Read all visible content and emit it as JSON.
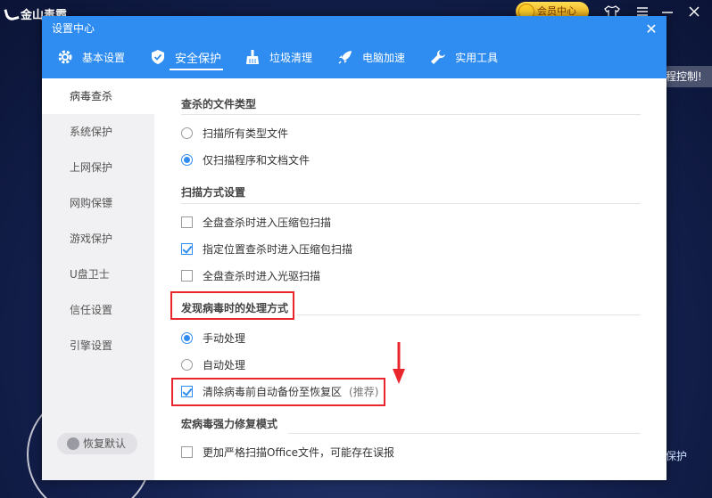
{
  "background_app": {
    "logo_text": "金山毒霸",
    "member_center": "会员中心",
    "side_tab_text": "程控制!",
    "bottom_link": "保护"
  },
  "dialog": {
    "title": "设置中心",
    "close_glyph": "✕"
  },
  "tabs": [
    {
      "label": "基本设置",
      "icon": "gear-icon",
      "active": false
    },
    {
      "label": "安全保护",
      "icon": "shield-icon",
      "active": true
    },
    {
      "label": "垃圾清理",
      "icon": "broom-icon",
      "active": false
    },
    {
      "label": "电脑加速",
      "icon": "rocket-icon",
      "active": false
    },
    {
      "label": "实用工具",
      "icon": "wrench-icon",
      "active": false
    }
  ],
  "sidebar": {
    "items": [
      {
        "label": "病毒查杀",
        "active": true
      },
      {
        "label": "系统保护",
        "active": false
      },
      {
        "label": "上网保护",
        "active": false
      },
      {
        "label": "网购保镖",
        "active": false
      },
      {
        "label": "游戏保护",
        "active": false
      },
      {
        "label": "U盘卫士",
        "active": false
      },
      {
        "label": "信任设置",
        "active": false
      },
      {
        "label": "引擎设置",
        "active": false
      }
    ],
    "restore_label": "恢复默认"
  },
  "sections": {
    "file_types": {
      "title": "查杀的文件类型",
      "options": [
        {
          "label": "扫描所有类型文件",
          "checked": false
        },
        {
          "label": "仅扫描程序和文档文件",
          "checked": true
        }
      ]
    },
    "scan_mode": {
      "title": "扫描方式设置",
      "options": [
        {
          "label": "全盘查杀时进入压缩包扫描",
          "checked": false
        },
        {
          "label": "指定位置查杀时进入压缩包扫描",
          "checked": true
        },
        {
          "label": "全盘查杀时进入光驱扫描",
          "checked": false
        }
      ]
    },
    "virus_handling": {
      "title": "发现病毒时的处理方式",
      "options": [
        {
          "label": "手动处理",
          "checked": true
        },
        {
          "label": "自动处理",
          "checked": false
        }
      ],
      "backup": {
        "label": "清除病毒前自动备份至恢复区",
        "recommend": "(推荐)",
        "checked": true
      }
    },
    "macro_repair": {
      "title": "宏病毒强力修复模式",
      "options": [
        {
          "label": "更加严格扫描Office文件，可能存在误报",
          "checked": false
        }
      ]
    }
  },
  "colors": {
    "header_blue": "#2f8cf0",
    "highlight_red": "#e8262b"
  }
}
